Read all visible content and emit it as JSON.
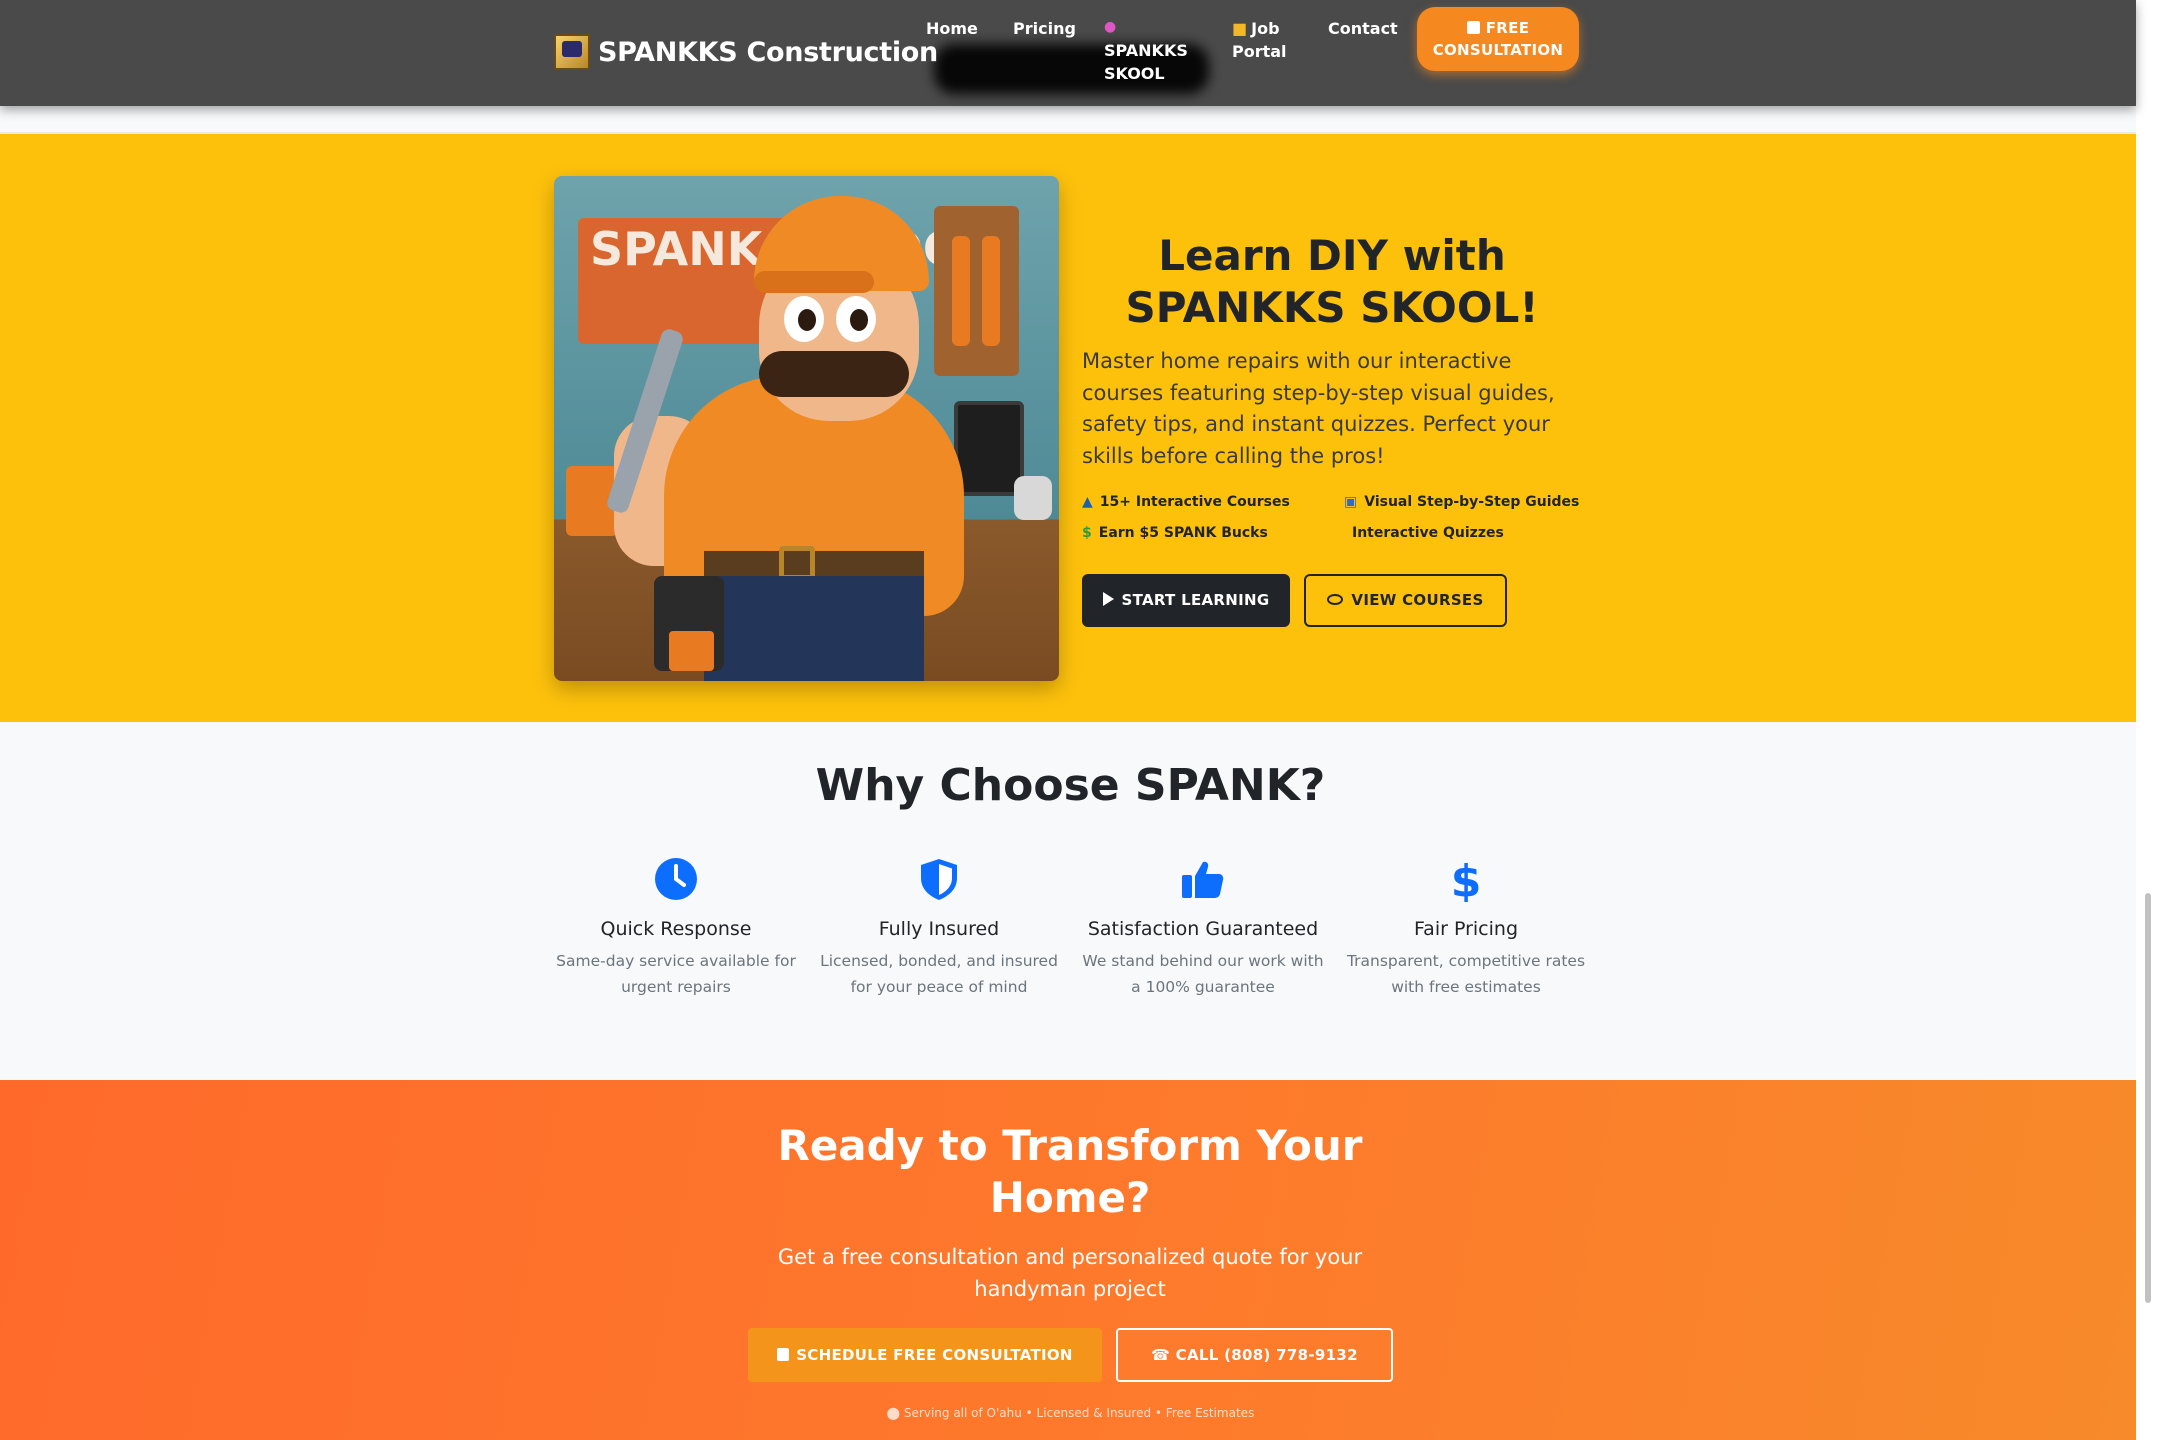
{
  "nav": {
    "brand": "SPANKKS Construction",
    "items": [
      {
        "label": "Home"
      },
      {
        "label": "Pricing"
      },
      {
        "label": "SPANKKS SKOOL",
        "icon": "brain-icon"
      },
      {
        "label": "Job Portal",
        "icon": "briefcase-icon"
      },
      {
        "label": "Contact"
      }
    ],
    "cta_label": "FREE CONSULTATION",
    "cta_icon": "calendar-icon"
  },
  "hero": {
    "image_alt": "SPANK SCHOOL handyman mascot",
    "sign_text": "SPANK SCHOOL",
    "title": "Learn DIY with SPANKKS SKOOL!",
    "description": "Master home repairs with our interactive courses featuring step-by-step visual guides, safety tips, and instant quizzes. Perfect your skills before calling the pros!",
    "features": [
      {
        "label": "15+ Interactive Courses",
        "icon": "graduation-cap-icon"
      },
      {
        "label": "Visual Step-by-Step Guides",
        "icon": "images-icon"
      },
      {
        "label": "Earn $5 SPANK Bucks",
        "icon": "dollar-icon"
      },
      {
        "label": "Interactive Quizzes",
        "icon": ""
      }
    ],
    "primary_button": "START LEARNING",
    "secondary_button": "VIEW COURSES"
  },
  "why": {
    "title": "Why Choose SPANK?",
    "cards": [
      {
        "title": "Quick Response",
        "desc": "Same-day service available for urgent repairs",
        "icon": "clock-icon"
      },
      {
        "title": "Fully Insured",
        "desc": "Licensed, bonded, and insured for your peace of mind",
        "icon": "shield-icon"
      },
      {
        "title": "Satisfaction Guaranteed",
        "desc": "We stand behind our work with a 100% guarantee",
        "icon": "thumbs-up-icon"
      },
      {
        "title": "Fair Pricing",
        "desc": "Transparent, competitive rates with free estimates",
        "icon": "dollar-icon"
      }
    ]
  },
  "cta": {
    "title": "Ready to Transform Your Home?",
    "subtitle": "Get a free consultation and personalized quote for your handyman project",
    "schedule_button": "SCHEDULE FREE CONSULTATION",
    "call_button": "CALL (808) 778-9132",
    "footnote": "Serving all of O'ahu • Licensed & Insured • Free Estimates"
  },
  "colors": {
    "nav_bg": "#4a4a4a",
    "hero_bg": "#fdc10c",
    "accent_orange": "#f5891f",
    "cta_gradient_start": "#ff6a2b",
    "icon_blue": "#0d6efd",
    "dark": "#212529"
  }
}
